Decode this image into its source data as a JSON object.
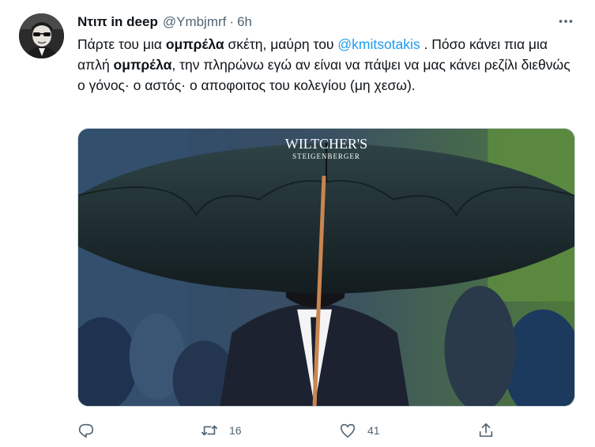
{
  "author": {
    "display_name": "Ντιπ in deep",
    "handle": "@Ymbjmrf",
    "separator": "·",
    "timestamp": "6h",
    "avatar_icon": "avatar-photo"
  },
  "tweet": {
    "segments": [
      {
        "text": "Πάρτε του μια ",
        "style": "plain"
      },
      {
        "text": "ομπρέλα",
        "style": "bold"
      },
      {
        "text": " σκέτη, μαύρη του  ",
        "style": "plain"
      },
      {
        "text": "@kmitsotakis",
        "style": "mention"
      },
      {
        "text": " . Πόσο κάνει πια μια απλή ",
        "style": "plain"
      },
      {
        "text": "ομπρέλα",
        "style": "bold"
      },
      {
        "text": ", την πληρώνω εγώ αν είναι να πάψει να μας κάνει ρεζίλι διεθνώς ο γόνος· ο  αστός· ο  αποφοιτος του κολεγίου (μη χεσω).",
        "style": "plain"
      }
    ]
  },
  "media": {
    "umbrella_text_line1": "WILTCHER'S",
    "umbrella_text_line2": "STEIGENBERGER"
  },
  "actions": {
    "reply": {
      "icon": "reply-icon",
      "count": ""
    },
    "retweet": {
      "icon": "retweet-icon",
      "count": "16"
    },
    "like": {
      "icon": "heart-icon",
      "count": "41"
    },
    "share": {
      "icon": "share-icon",
      "count": ""
    }
  },
  "colors": {
    "text_primary": "#0f1419",
    "text_secondary": "#536471",
    "mention": "#1d9bf0",
    "border": "#cfd9de"
  }
}
